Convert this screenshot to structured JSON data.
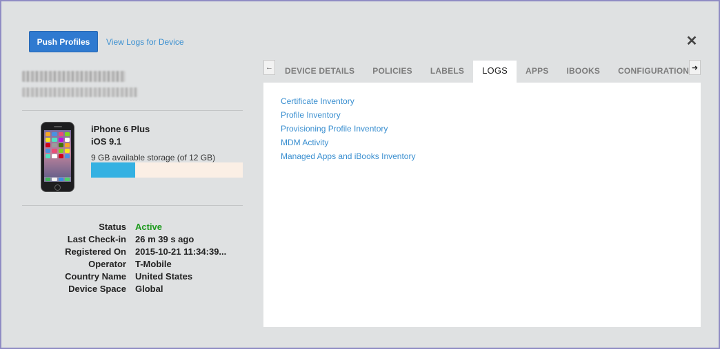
{
  "header": {
    "push_profiles_label": "Push Profiles",
    "view_logs_label": "View Logs for Device",
    "close_icon": "close-icon"
  },
  "device": {
    "model": "iPhone 6 Plus",
    "os": "iOS 9.1",
    "storage_text": "9 GB available storage (of 12 GB)",
    "storage_used_fraction": 0.29
  },
  "info": [
    {
      "label": "Status",
      "value": "Active"
    },
    {
      "label": "Last Check-in",
      "value": "26 m 39 s ago"
    },
    {
      "label": "Registered On",
      "value": "2015-10-21 11:34:39..."
    },
    {
      "label": "Operator",
      "value": "T-Mobile"
    },
    {
      "label": "Country Name",
      "value": "United States"
    },
    {
      "label": "Device Space",
      "value": "Global"
    }
  ],
  "tabs": [
    {
      "label": "DEVICE DETAILS"
    },
    {
      "label": "POLICIES"
    },
    {
      "label": "LABELS"
    },
    {
      "label": "LOGS"
    },
    {
      "label": "APPS"
    },
    {
      "label": "IBOOKS"
    },
    {
      "label": "CONFIGURATIONS"
    }
  ],
  "active_tab": "LOGS",
  "logs": {
    "links": [
      "Certificate Inventory",
      "Profile Inventory",
      "Provisioning Profile Inventory",
      "MDM Activity",
      "Managed Apps and iBooks Inventory"
    ]
  },
  "colors": {
    "accent": "#2f7ad0",
    "link": "#3a8fd0",
    "active_status": "#1e9a1e",
    "storage_fill": "#34b1e2"
  }
}
